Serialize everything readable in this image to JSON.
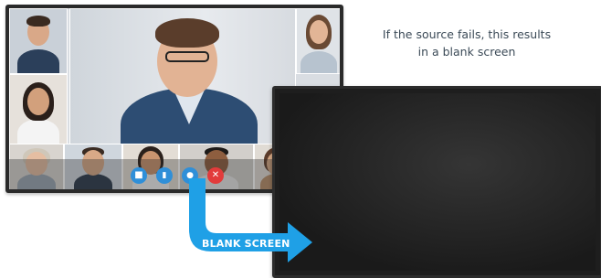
{
  "caption": {
    "line1": "If the source fails, this results",
    "line2": "in a blank screen"
  },
  "arrow_label": "BLANK SCREEN",
  "call_controls": [
    {
      "name": "camera-icon",
      "color": "#2f8fd8",
      "glyph": "■"
    },
    {
      "name": "signal-icon",
      "color": "#2f8fd8",
      "glyph": "▮"
    },
    {
      "name": "chat-icon",
      "color": "#2f8fd8",
      "glyph": "●"
    },
    {
      "name": "hang-up-icon",
      "color": "#e23b3b",
      "glyph": "✕"
    }
  ],
  "colors": {
    "arrow": "#1fa0e6",
    "hang_up": "#e23b3b",
    "control_blue": "#2f8fd8",
    "caption_text": "#3b4a57"
  }
}
